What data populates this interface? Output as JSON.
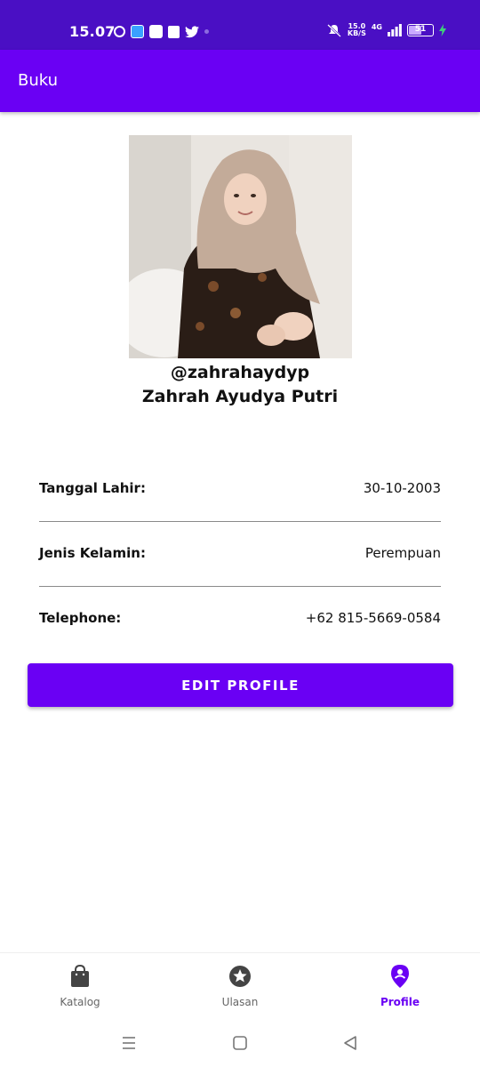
{
  "status_bar": {
    "time": "15.07",
    "net_speed_value": "15.0",
    "net_speed_unit": "KB/S",
    "network": "4G",
    "battery": "51"
  },
  "app_bar": {
    "title": "Buku"
  },
  "profile": {
    "username": "@zahrahaydyp",
    "full_name": "Zahrah Ayudya Putri",
    "photo_icon": "profile-photo"
  },
  "info": [
    {
      "label": "Tanggal Lahir:",
      "value": "30-10-2003"
    },
    {
      "label": "Jenis Kelamin:",
      "value": "Perempuan"
    },
    {
      "label": "Telephone:",
      "value": "+62 815-5669-0584"
    }
  ],
  "edit_button": {
    "label": "EDIT PROFILE"
  },
  "bottom_nav": {
    "items": [
      {
        "label": "Katalog",
        "icon": "shopping-bag-icon",
        "active": false
      },
      {
        "label": "Ulasan",
        "icon": "star-icon",
        "active": false
      },
      {
        "label": "Profile",
        "icon": "location-pin-icon",
        "active": true
      }
    ]
  },
  "colors": {
    "primary": "#6a00f4",
    "status_bar": "#4a0fc4",
    "inactive_icon": "#444444"
  }
}
